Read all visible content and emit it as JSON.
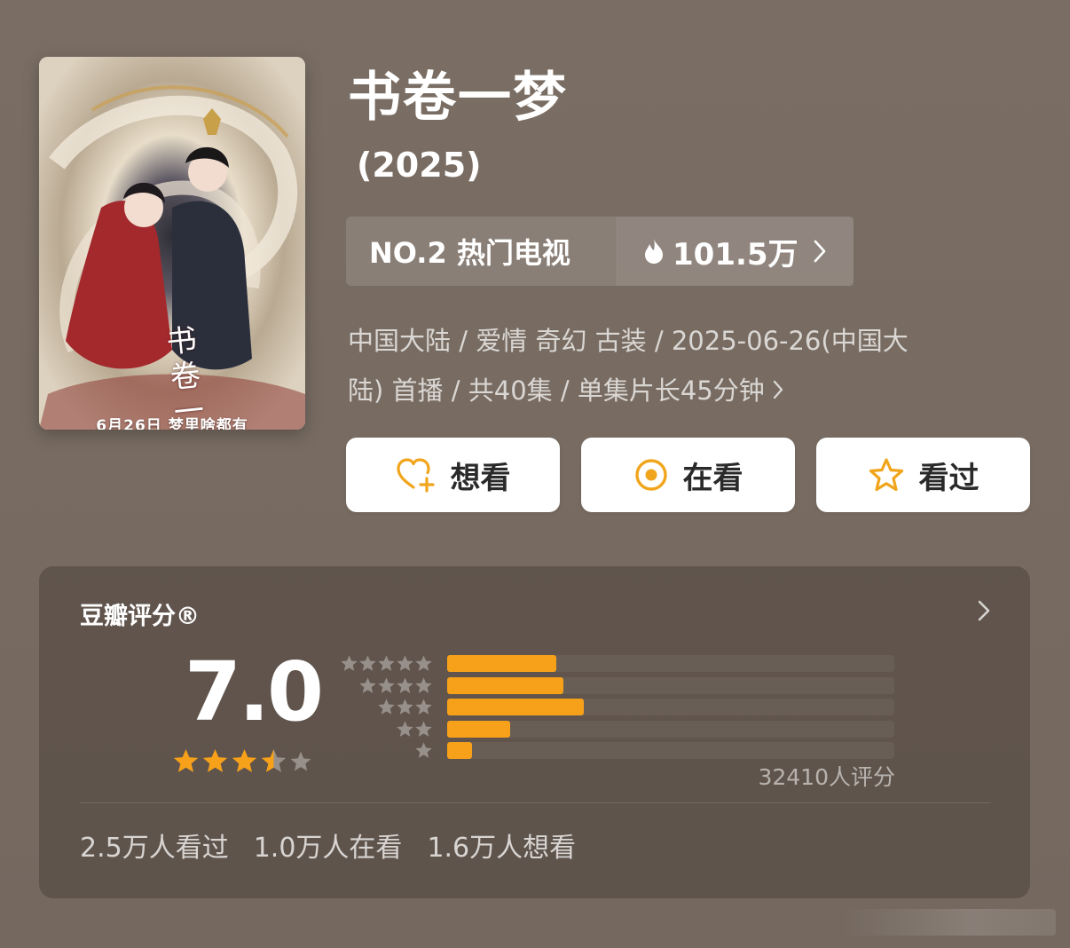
{
  "poster": {
    "calligraphy": "书卷一梦",
    "caption": "6月26日 梦里啥都有"
  },
  "title": "书卷一梦",
  "year": "(2025)",
  "rank": {
    "label": "NO.2 热门电视",
    "heat": "101.5万",
    "icon": "flame-icon"
  },
  "meta": {
    "line1": "中国大陆 / 爱情 奇幻 古装 / 2025-06-26(中国大",
    "line2": "陆) 首播 / 共40集 / 单集片长45分钟"
  },
  "actions": {
    "want": "想看",
    "watching": "在看",
    "watched": "看过"
  },
  "rating": {
    "title": "豆瓣评分®",
    "score": "7.0",
    "score_stars": 3.5,
    "rating_count": "32410人评分",
    "distribution": [
      {
        "stars": 5,
        "fraction": 0.245
      },
      {
        "stars": 4,
        "fraction": 0.26
      },
      {
        "stars": 3,
        "fraction": 0.305
      },
      {
        "stars": 2,
        "fraction": 0.14
      },
      {
        "stars": 1,
        "fraction": 0.055
      }
    ]
  },
  "stats": {
    "watched": "2.5万人看过",
    "watching": "1.0万人在看",
    "want": "1.6万人想看"
  },
  "colors": {
    "accent": "#f7a11a",
    "background": "#786c62",
    "button_bg": "#ffffff"
  }
}
